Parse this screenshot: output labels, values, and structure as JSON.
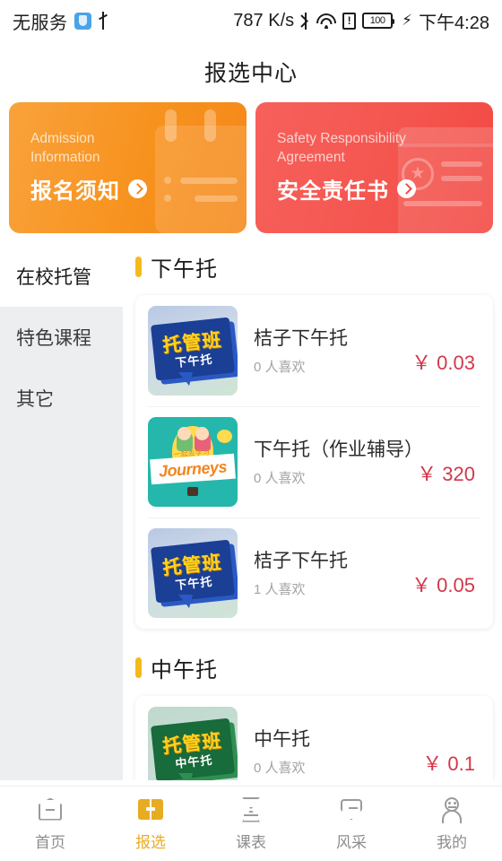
{
  "status_bar": {
    "carrier": "无服务",
    "shield_icon": "shield-icon",
    "usb_icon": "usb-icon",
    "network_speed": "787 K/s",
    "bluetooth_icon": "bluetooth-icon",
    "wifi_icon": "wifi-icon",
    "sim_icon": "sim-alert-icon",
    "battery_level": "100",
    "charging_icon": "charging-bolt-icon",
    "time": "下午4:28"
  },
  "header": {
    "title": "报选中心"
  },
  "banners": [
    {
      "en_line1": "Admission",
      "en_line2": "Information",
      "cn": "报名须知",
      "arrow_icon": "chevron-right-icon",
      "color": "#F7921E",
      "decoration": "clipboard-icon"
    },
    {
      "en_line1": "Safety Responsibility",
      "en_line2": "Agreement",
      "cn": "安全责任书",
      "arrow_icon": "chevron-right-icon",
      "color": "#F4564F",
      "decoration": "certificate-icon"
    }
  ],
  "sidebar": {
    "items": [
      {
        "label": "在校托管",
        "active": true
      },
      {
        "label": "特色课程",
        "active": false
      },
      {
        "label": "其它",
        "active": false
      }
    ]
  },
  "sections": [
    {
      "title": "下午托",
      "accent": "#F5B91E",
      "courses": [
        {
          "name": "桔子下午托",
          "likes": "0 人喜欢",
          "price": "￥ 0.03",
          "thumb_style": "blue",
          "thumb_title": "托管班",
          "thumb_sub": "下午托"
        },
        {
          "name": "下午托（作业辅导）",
          "likes": "0 人喜欢",
          "price": "￥ 320",
          "thumb_style": "teal",
          "thumb_title": "Journeys",
          "thumb_sub": "一起去学习"
        },
        {
          "name": "桔子下午托",
          "likes": "1 人喜欢",
          "price": "￥ 0.05",
          "thumb_style": "blue",
          "thumb_title": "托管班",
          "thumb_sub": "下午托"
        }
      ]
    },
    {
      "title": "中午托",
      "accent": "#F5B91E",
      "courses": [
        {
          "name": "中午托",
          "likes": "0 人喜欢",
          "price": "￥ 0.1",
          "thumb_style": "green",
          "thumb_title": "托管班",
          "thumb_sub": "中午托"
        }
      ]
    }
  ],
  "tabbar": {
    "items": [
      {
        "label": "首页",
        "icon": "home-icon",
        "active": false
      },
      {
        "label": "报选",
        "icon": "book-icon",
        "active": true
      },
      {
        "label": "课表",
        "icon": "hourglass-icon",
        "active": false
      },
      {
        "label": "风采",
        "icon": "shield-icon",
        "active": false
      },
      {
        "label": "我的",
        "icon": "person-icon",
        "active": false
      }
    ],
    "active_color": "#E8AC22",
    "inactive_color": "#8d8d8d"
  }
}
